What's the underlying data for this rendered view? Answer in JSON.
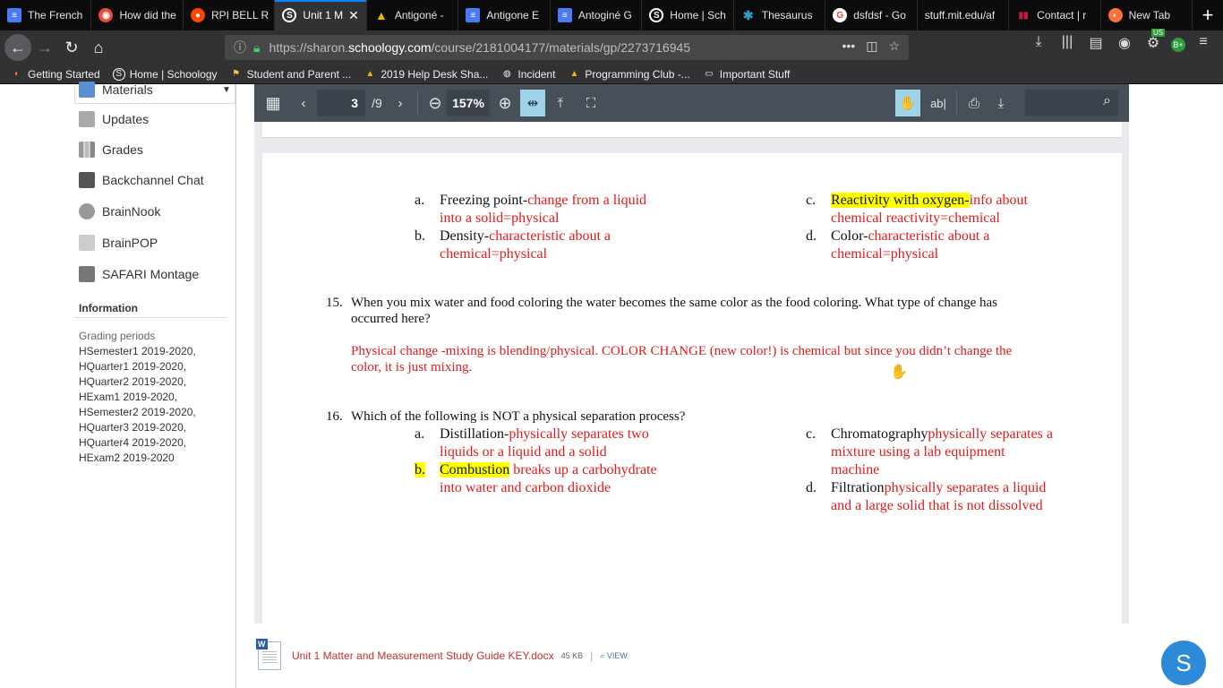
{
  "tabs": [
    {
      "label": "The French",
      "icon": "google-docs-icon",
      "color": "#4a7bf7"
    },
    {
      "label": "How did the",
      "icon": "red-badge-icon",
      "color": "#e74c3c"
    },
    {
      "label": "RPI BELL R",
      "icon": "reddit-icon",
      "color": "#ff4500"
    },
    {
      "label": "Unit 1 M",
      "icon": "schoology-icon",
      "color": "#ffffff",
      "active": true
    },
    {
      "label": "Antigoné -",
      "icon": "google-drive-icon",
      "color": "#f4b400"
    },
    {
      "label": "Antigone E",
      "icon": "google-docs-icon",
      "color": "#4a7bf7"
    },
    {
      "label": "Antoginé G",
      "icon": "google-docs-icon",
      "color": "#4a7bf7"
    },
    {
      "label": "Home | Sch",
      "icon": "schoology-icon",
      "color": "#ffffff"
    },
    {
      "label": "Thesaurus",
      "icon": "thesaurus-icon",
      "color": "#2aa1d6"
    },
    {
      "label": "dsfdsf - Go",
      "icon": "google-icon",
      "color": "#ea4335"
    },
    {
      "label": "stuff.mit.edu/af",
      "icon": "",
      "color": ""
    },
    {
      "label": "Contact | r",
      "icon": "rpi-icon",
      "color": "#c41e3a"
    },
    {
      "label": "New Tab",
      "icon": "firefox-icon",
      "color": "#ff7139"
    }
  ],
  "url": {
    "prefix": "https://sharon.",
    "host": "schoology.com",
    "path": "/course/2181004177/materials/gp/2273716945"
  },
  "toolbar_badges": {
    "ext1": "US",
    "ext2": "B+"
  },
  "bookmarks": [
    {
      "label": "Getting Started",
      "icon": "firefox-icon"
    },
    {
      "label": "Home | Schoology",
      "icon": "schoology-icon"
    },
    {
      "label": "Student and Parent ...",
      "icon": "flag-icon"
    },
    {
      "label": "2019 Help Desk Sha...",
      "icon": "google-drive-icon"
    },
    {
      "label": "Incident",
      "icon": "globe-icon"
    },
    {
      "label": "Programming Club -...",
      "icon": "google-drive-icon"
    },
    {
      "label": "Important Stuff",
      "icon": "folder-icon"
    }
  ],
  "sidebar": {
    "items": [
      {
        "label": "Materials"
      },
      {
        "label": "Updates"
      },
      {
        "label": "Grades"
      },
      {
        "label": "Backchannel Chat"
      },
      {
        "label": "BrainNook"
      },
      {
        "label": "BrainPOP"
      },
      {
        "label": "SAFARI Montage"
      }
    ],
    "info_heading": "Information",
    "grading_label": "Grading periods",
    "grading_periods": [
      "HSemester1 2019-2020,",
      "HQuarter1 2019-2020,",
      "HQuarter2 2019-2020,",
      "HExam1 2019-2020,",
      "HSemester2 2019-2020,",
      "HQuarter3 2019-2020,",
      "HQuarter4 2019-2020,",
      "HExam2 2019-2020"
    ]
  },
  "viewer": {
    "page_current": "3",
    "page_total": "/9",
    "zoom": "157%"
  },
  "document": {
    "q14": {
      "a": {
        "letter": "a.",
        "term": "Freezing point-",
        "answer_l1": "change from a liquid",
        "answer_l2": "into a solid=physical"
      },
      "b": {
        "letter": "b.",
        "term": "Density-",
        "answer_l1": "characteristic about a",
        "answer_l2": "chemical=physical"
      },
      "c": {
        "letter": "c.",
        "term": "Reactivity with oxygen-",
        "answer_l1": "info about",
        "answer_l2": "chemical reactivity=chemical"
      },
      "d": {
        "letter": "d.",
        "term": "Color-",
        "answer_l1": "characteristic about a",
        "answer_l2": "chemical=physical"
      }
    },
    "q15": {
      "num": "15.",
      "q_l1": "When you mix water and food coloring the water becomes the same color as the food coloring. What type of change has",
      "q_l2": "occurred here?",
      "a_l1": "Physical change -mixing is blending/physical. COLOR CHANGE (new color!) is chemical but since you didn’t change the",
      "a_l2": "color, it is just mixing."
    },
    "q16": {
      "num": "16.",
      "question": "Which of the following is NOT a physical separation process?",
      "a": {
        "letter": "a.",
        "term": "Distillation-",
        "answer_l1": "physically separates two",
        "answer_l2": "liquids or a liquid and a solid"
      },
      "b": {
        "letter": "b.",
        "term": "Combustion",
        "answer_l1": " breaks up a carbohydrate",
        "answer_l2": "into water and carbon dioxide"
      },
      "c": {
        "letter": "c.",
        "term": "Chromatography",
        "answer_l1": "physically separates a",
        "answer_l2": "mixture using a lab equipment",
        "answer_l3": "machine"
      },
      "d": {
        "letter": "d.",
        "term": "Filtration",
        "answer_l1": "physically separates a liquid",
        "answer_l2": "and a large solid that is not dissolved"
      }
    }
  },
  "attachment": {
    "name": "Unit 1 Matter and Measurement Study Guide KEY.docx",
    "size": "45 KB",
    "sep": "|",
    "view_label": "VIEW"
  },
  "fab_label": "S",
  "colors": {
    "answer_red": "#e01b1b",
    "highlight": "#ffff00",
    "viewer_toolbar": "#474f59",
    "accent_blue": "#0a84ff"
  }
}
